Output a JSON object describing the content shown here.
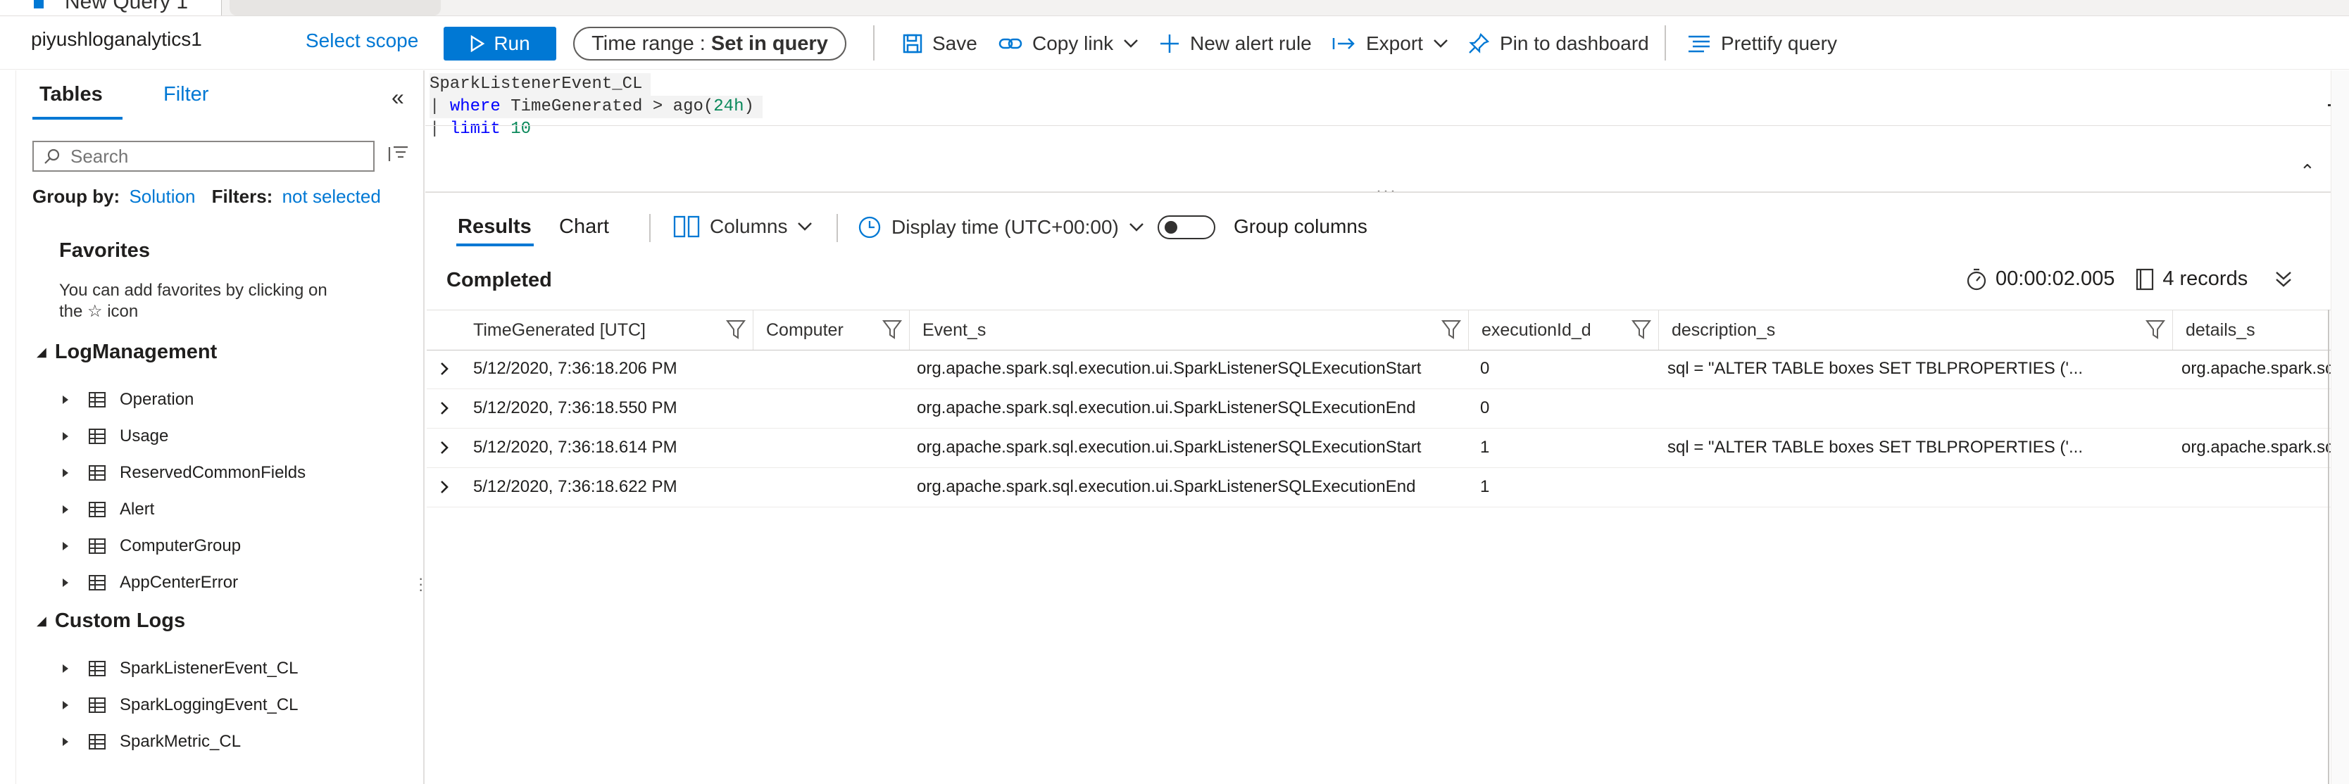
{
  "tabs": {
    "active_label": "New Query 1"
  },
  "toolbar": {
    "workspace": "piyushloganalytics1",
    "select_scope": "Select scope",
    "run": "Run",
    "time_range_prefix": "Time range : ",
    "time_range_value": "Set in query",
    "save": "Save",
    "copy_link": "Copy link",
    "new_alert_rule": "New alert rule",
    "export": "Export",
    "pin_to_dashboard": "Pin to dashboard",
    "prettify_query": "Prettify query"
  },
  "sidebar": {
    "tab_tables": "Tables",
    "tab_filter": "Filter",
    "search_placeholder": "Search",
    "group_by_label": "Group by:",
    "group_by_value": "Solution",
    "filters_label": "Filters:",
    "filters_value": "not selected",
    "favorites_title": "Favorites",
    "favorites_hint": "You can add favorites by clicking on the ☆ icon",
    "groups": [
      {
        "title": "LogManagement",
        "items": [
          "Operation",
          "Usage",
          "ReservedCommonFields",
          "Alert",
          "ComputerGroup",
          "AppCenterError"
        ]
      },
      {
        "title": "Custom Logs",
        "items": [
          "SparkListenerEvent_CL",
          "SparkLoggingEvent_CL",
          "SparkMetric_CL"
        ]
      }
    ]
  },
  "editor": {
    "line1": "SparkListenerEvent_CL",
    "line2_pipe": "| ",
    "line2_kw": "where",
    "line2_rest": " TimeGenerated > ago(",
    "line2_num": "24h",
    "line2_end": ")",
    "line3_pipe": "| ",
    "line3_kw": "limit",
    "line3_sp": " ",
    "line3_num": "10"
  },
  "results": {
    "tab_results": "Results",
    "tab_chart": "Chart",
    "columns": "Columns",
    "display_time": "Display time (UTC+00:00)",
    "group_columns": "Group columns",
    "status": "Completed",
    "duration": "00:00:02.005",
    "records": "4 records",
    "headers": [
      "TimeGenerated [UTC]",
      "Computer",
      "Event_s",
      "executionId_d",
      "description_s",
      "details_s"
    ],
    "rows": [
      [
        "5/12/2020, 7:36:18.206 PM",
        "",
        "org.apache.spark.sql.execution.ui.SparkListenerSQLExecutionStart",
        "0",
        "sql = \"ALTER TABLE boxes SET TBLPROPERTIES ('...",
        "org.apache.spark.sq"
      ],
      [
        "5/12/2020, 7:36:18.550 PM",
        "",
        "org.apache.spark.sql.execution.ui.SparkListenerSQLExecutionEnd",
        "0",
        "",
        ""
      ],
      [
        "5/12/2020, 7:36:18.614 PM",
        "",
        "org.apache.spark.sql.execution.ui.SparkListenerSQLExecutionStart",
        "1",
        "sql = \"ALTER TABLE boxes SET TBLPROPERTIES ('...",
        "org.apache.spark.sq"
      ],
      [
        "5/12/2020, 7:36:18.622 PM",
        "",
        "org.apache.spark.sql.execution.ui.SparkListenerSQLExecutionEnd",
        "1",
        "",
        ""
      ]
    ]
  },
  "colors": {
    "accent": "#0078d4",
    "text": "#323130"
  }
}
